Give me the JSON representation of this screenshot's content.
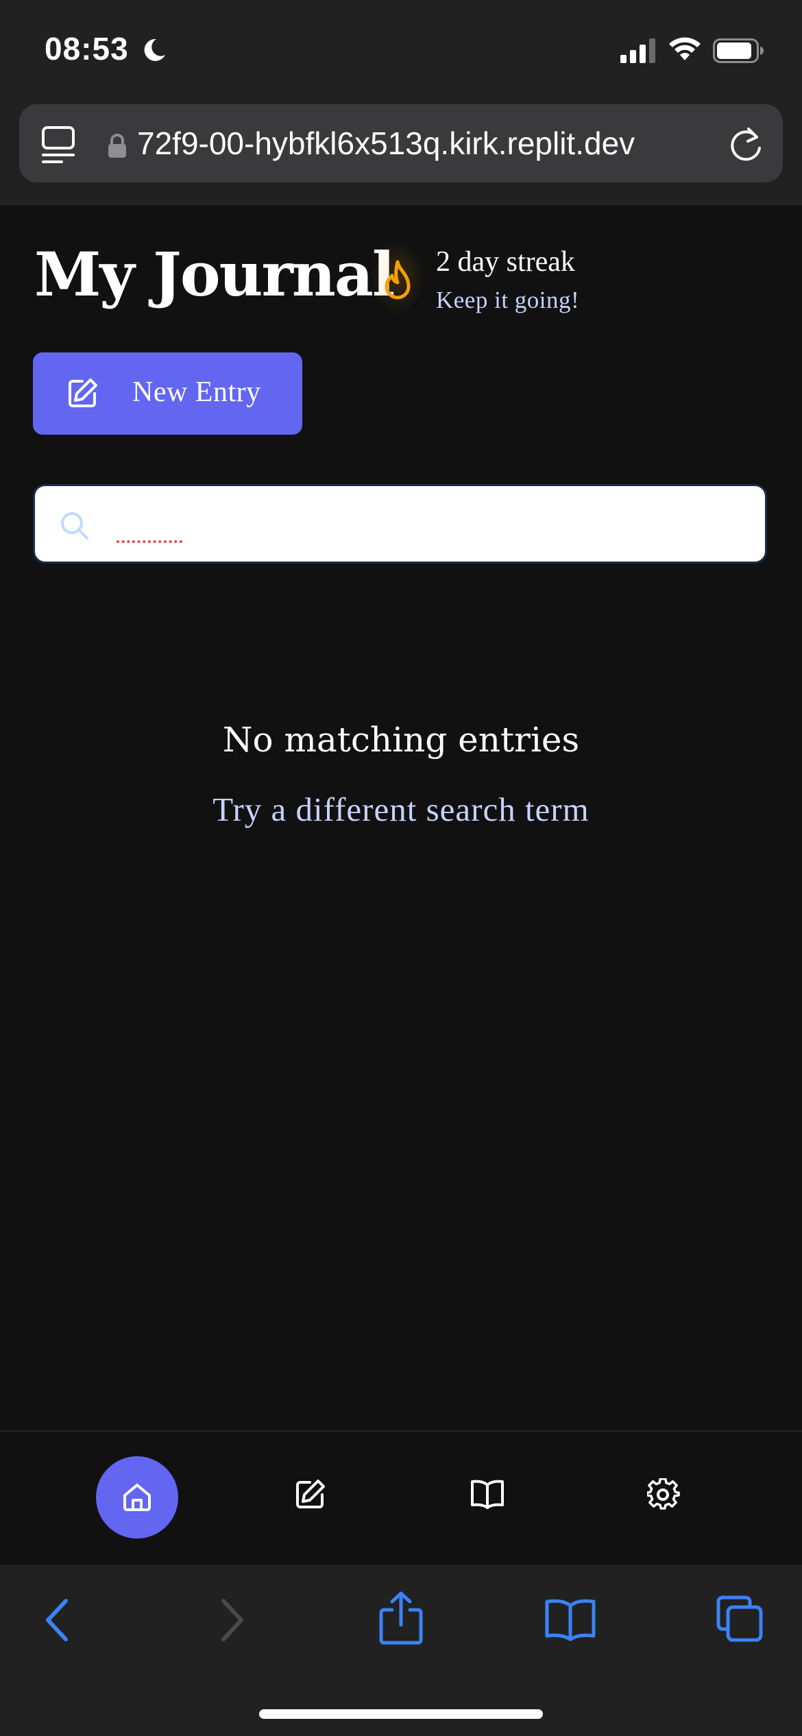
{
  "status_bar": {
    "time": "08:53"
  },
  "browser": {
    "url": "72f9-00-hybfkl6x513q.kirk.replit.dev"
  },
  "header": {
    "title": "My Journal",
    "streak_title": "2 day streak",
    "streak_subtitle": "Keep it going!"
  },
  "actions": {
    "new_entry_label": "New Entry"
  },
  "search": {
    "value": "",
    "placeholder": ""
  },
  "empty_state": {
    "title": "No matching entries",
    "subtitle": "Try a different search term"
  },
  "colors": {
    "accent": "#6366f1",
    "background": "#111111",
    "streak_flame": "#f59e0b",
    "muted_text": "#c7d2fe",
    "safari_blue": "#3b82f6"
  },
  "icons": {
    "app_nav": [
      "home-icon",
      "edit-icon",
      "book-icon",
      "settings-icon"
    ],
    "safari_toolbar": [
      "back-icon",
      "forward-icon",
      "share-icon",
      "bookmarks-icon",
      "tabs-icon"
    ]
  }
}
